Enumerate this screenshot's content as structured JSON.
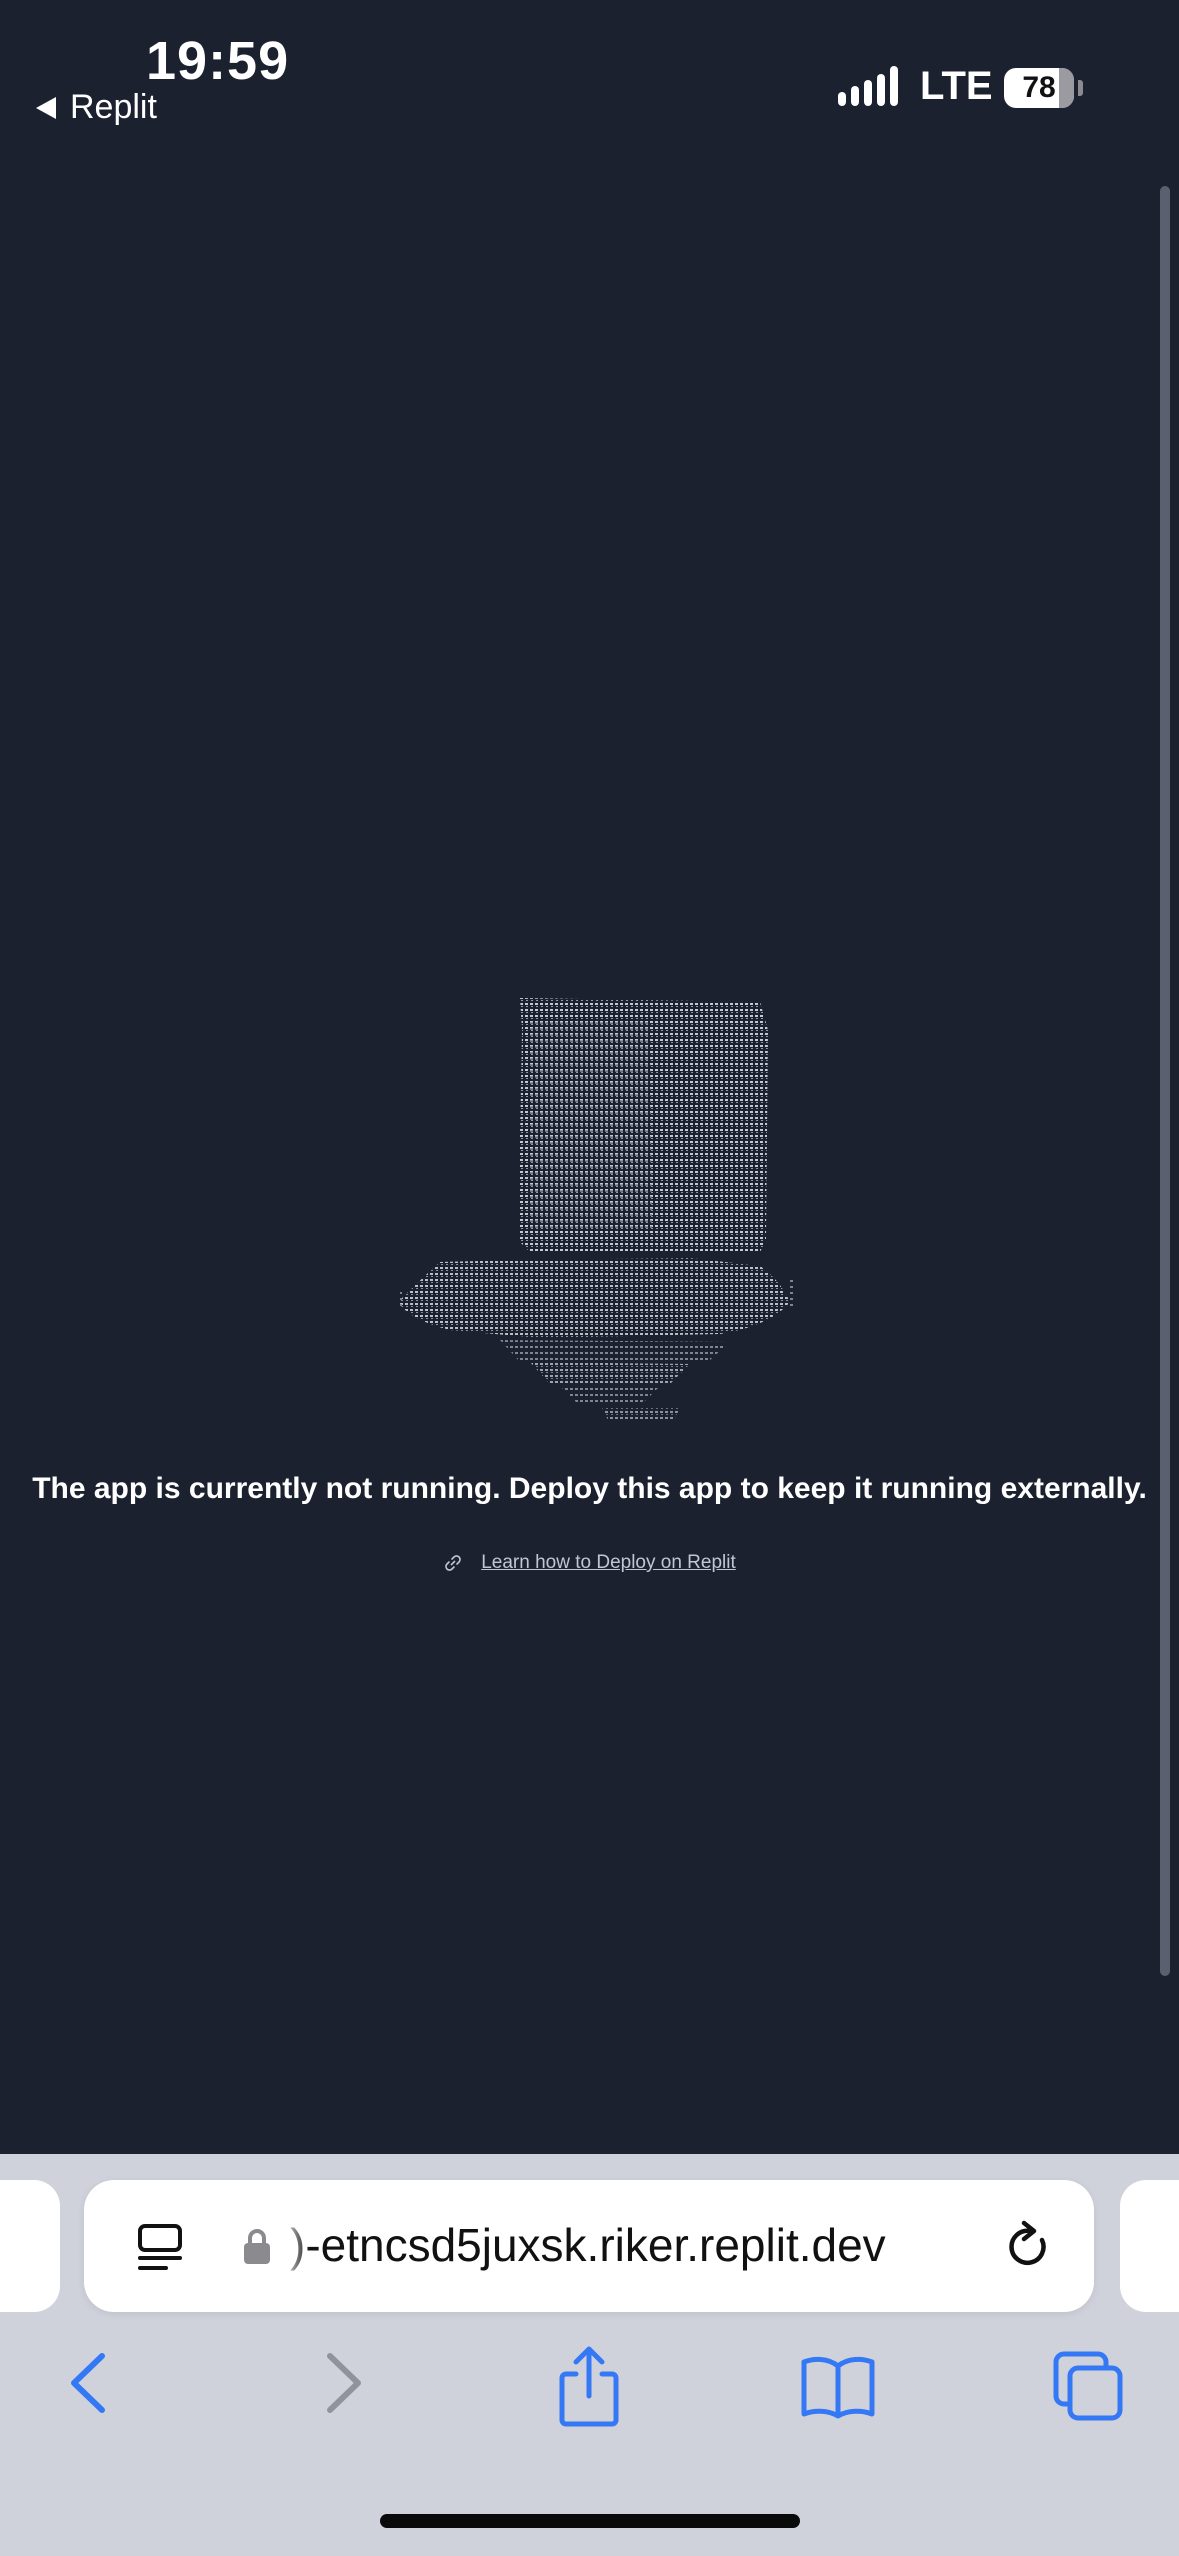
{
  "status_bar": {
    "time": "19:59",
    "back_app_label": "Replit",
    "network": "LTE",
    "battery_level": "78"
  },
  "page": {
    "message": "The app is currently not running. Deploy this app to keep it running externally.",
    "learn_link": "Learn how to Deploy on Replit"
  },
  "browser": {
    "url": ")-etncsd5juxsk.riker.replit.dev"
  },
  "colors": {
    "background": "#1c2130",
    "toolbar": "#cfd2db",
    "accent": "#3478f6"
  },
  "icons": {
    "back": "back-arrow-icon",
    "forward": "forward-arrow-icon",
    "share": "share-icon",
    "bookmarks": "bookmarks-icon",
    "tabs": "tabs-icon",
    "reader": "reader-mode-icon",
    "lock": "lock-icon",
    "reload": "reload-icon",
    "link": "link-icon"
  }
}
